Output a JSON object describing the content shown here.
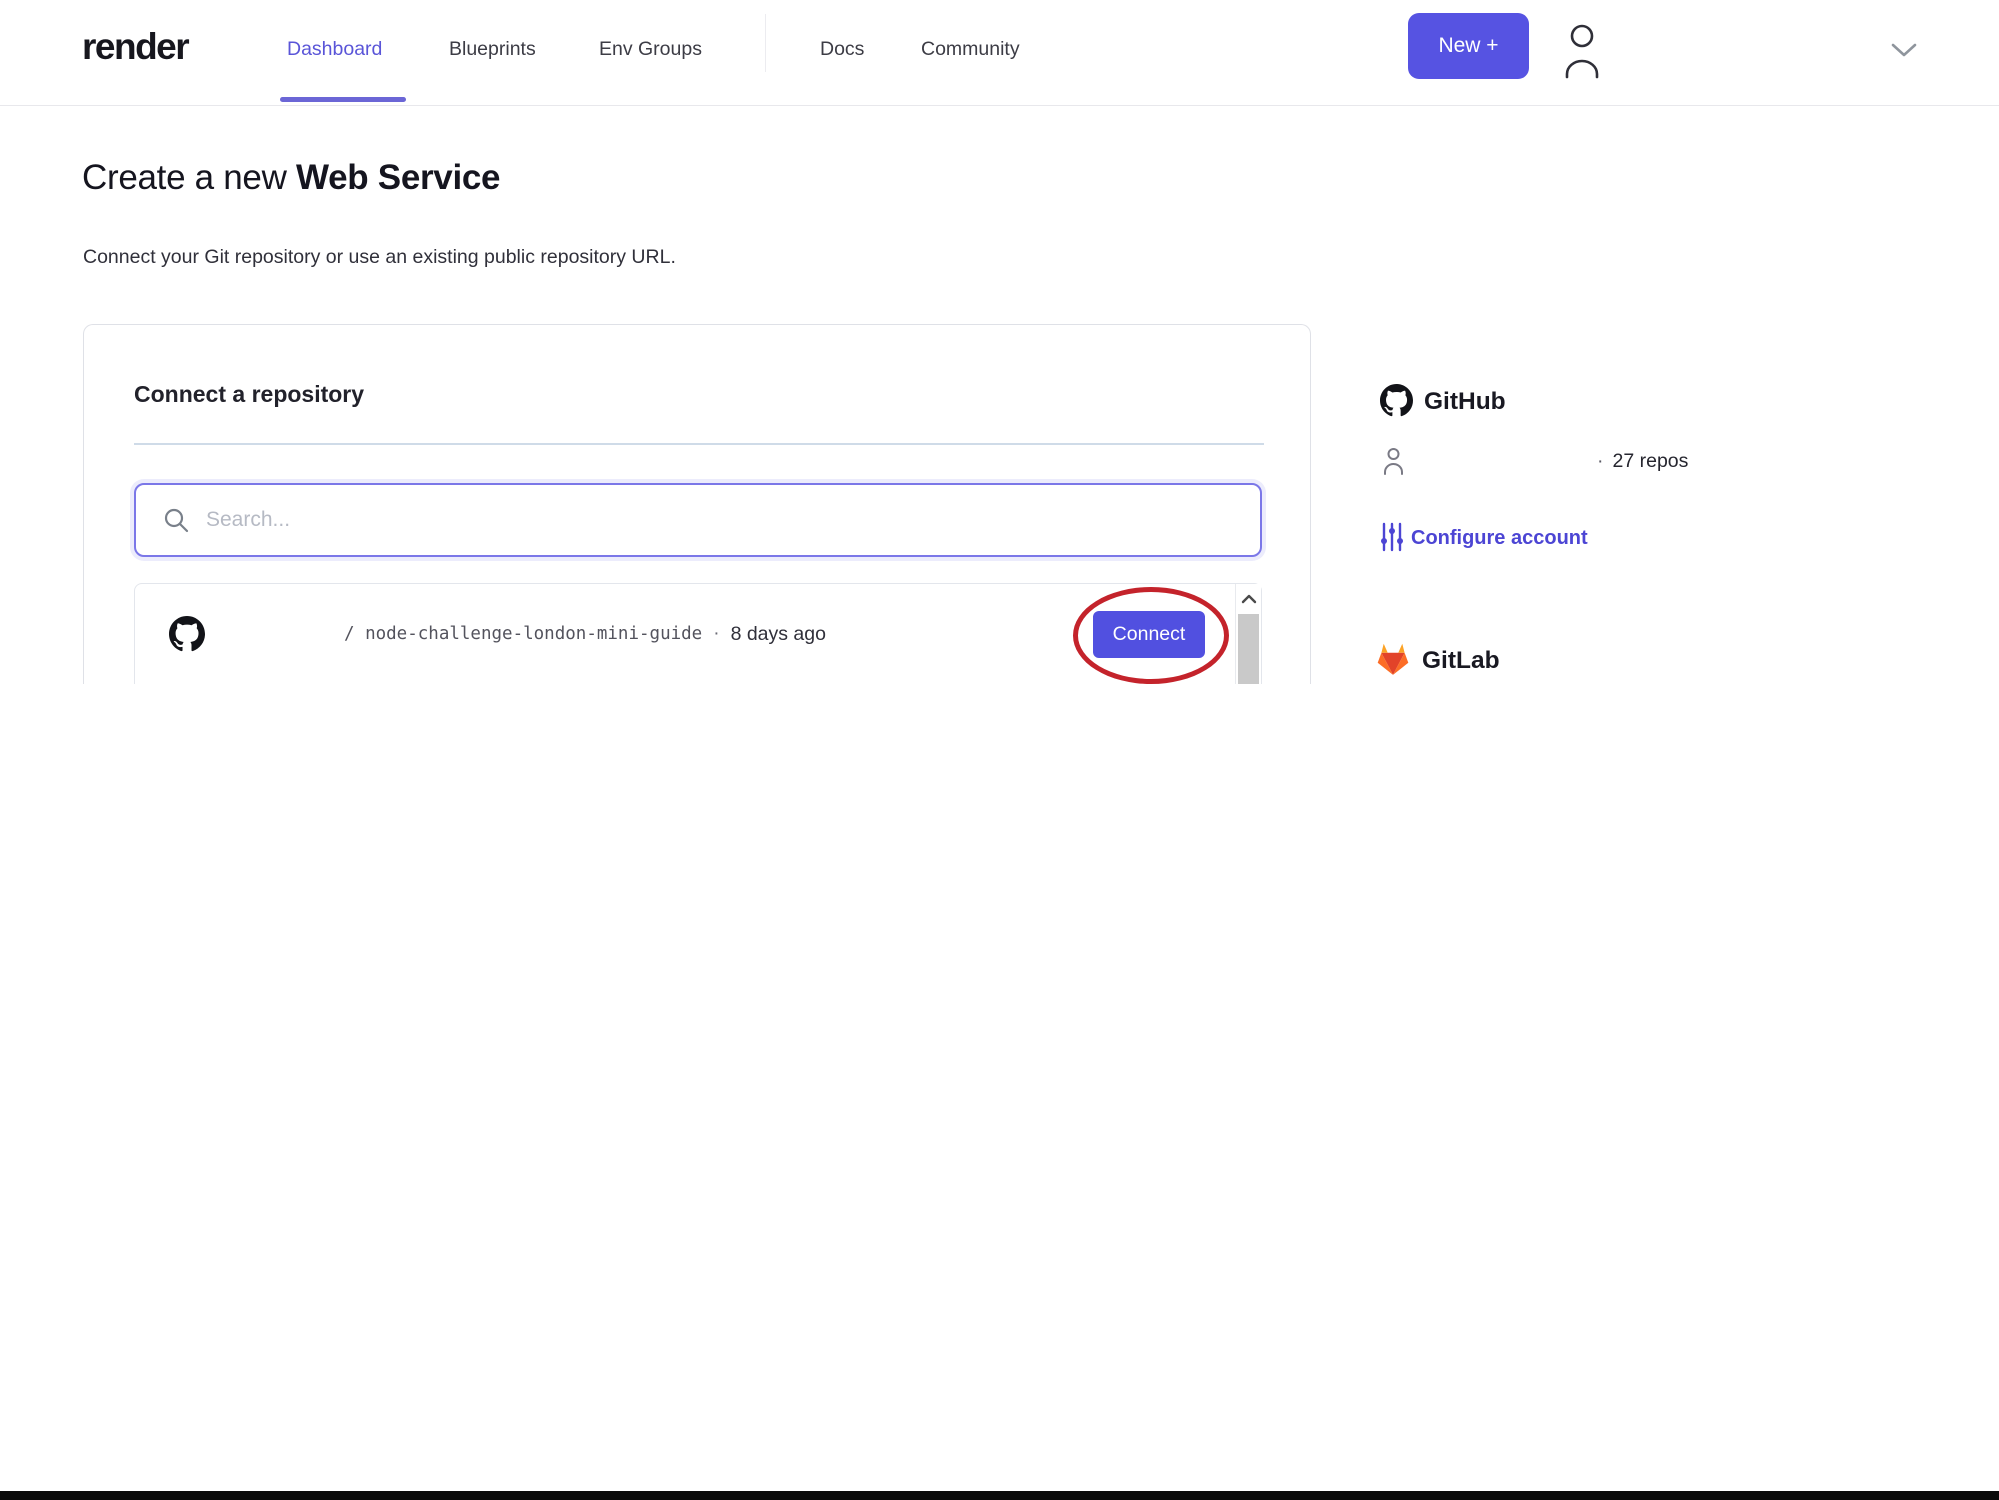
{
  "header": {
    "logo": "render",
    "nav": [
      {
        "label": "Dashboard",
        "active": true
      },
      {
        "label": "Blueprints",
        "active": false
      },
      {
        "label": "Env Groups",
        "active": false
      },
      {
        "label": "Docs",
        "active": false
      },
      {
        "label": "Community",
        "active": false
      }
    ],
    "new_button_label": "New +"
  },
  "page": {
    "title_prefix": "Create a new ",
    "title_emphasis": "Web Service",
    "subtitle": "Connect your Git repository or use an existing public repository URL."
  },
  "connect_card": {
    "heading": "Connect a repository",
    "search_placeholder": "Search...",
    "repo_row": {
      "repo_path": "/ node-challenge-london-mini-guide",
      "separator": "·",
      "updated": "8 days ago",
      "connect_label": "Connect"
    }
  },
  "sidebar": {
    "github": {
      "heading": "GitHub",
      "separator": "·",
      "repo_count": "27 repos",
      "configure_label": "Configure account"
    },
    "gitlab": {
      "heading": "GitLab"
    }
  },
  "colors": {
    "accent_indigo": "#5653e2",
    "connect_indigo": "#5150e0",
    "active_tab_purple": "#5a55d8",
    "link_purple": "#4c45d4",
    "annotation_red": "#c4232b",
    "divider_blue_gray": "#cfdbe8"
  }
}
